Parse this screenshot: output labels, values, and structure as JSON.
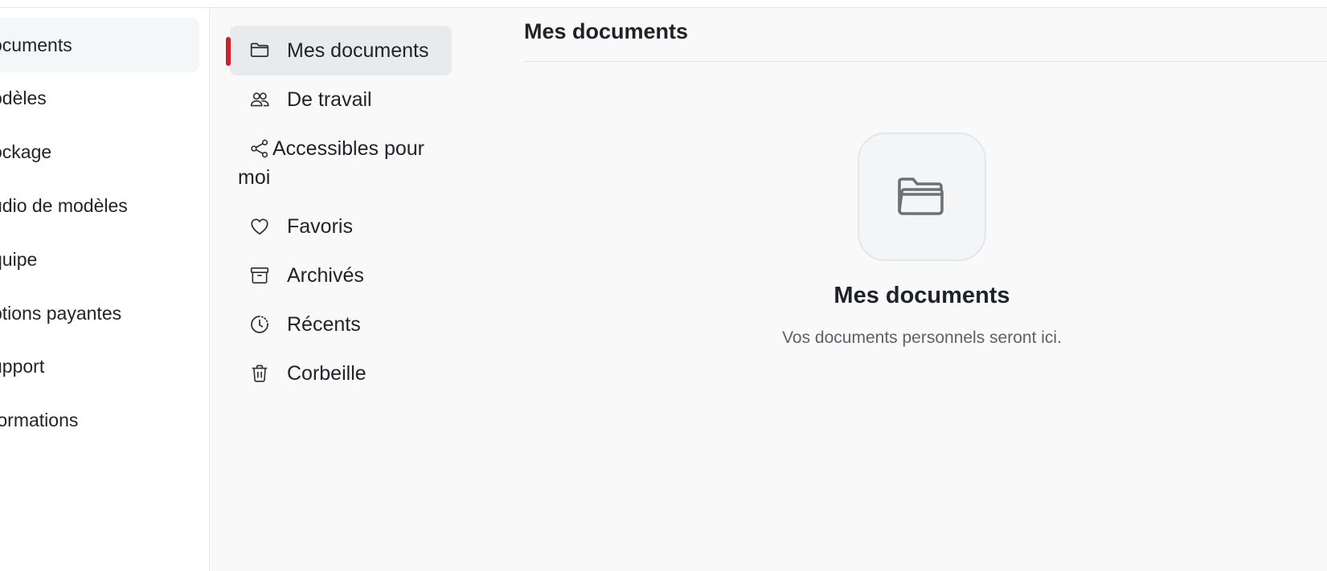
{
  "main_nav": {
    "items": [
      {
        "label": "ocuments",
        "active": true
      },
      {
        "label": "odèles"
      },
      {
        "label": "ockage"
      },
      {
        "label": "udio de modèles"
      },
      {
        "label": "quipe"
      },
      {
        "label": "ptions payantes"
      },
      {
        "label": "upport"
      },
      {
        "label": "formations"
      }
    ]
  },
  "sub_nav": {
    "accent_color": "#d21f2b",
    "items": [
      {
        "label": "Mes documents",
        "icon": "folder-icon",
        "active": true
      },
      {
        "label": "De travail",
        "icon": "users-icon"
      },
      {
        "label": "Accessibles pour moi",
        "icon": "share-icon"
      },
      {
        "label": "Favoris",
        "icon": "heart-icon"
      },
      {
        "label": "Archivés",
        "icon": "archive-icon"
      },
      {
        "label": "Récents",
        "icon": "clock-icon"
      },
      {
        "label": "Corbeille",
        "icon": "trash-icon"
      }
    ]
  },
  "content": {
    "title": "Mes documents",
    "empty_state": {
      "icon": "open-folder-icon",
      "title": "Mes documents",
      "subtitle": "Vos documents personnels seront ici."
    }
  }
}
